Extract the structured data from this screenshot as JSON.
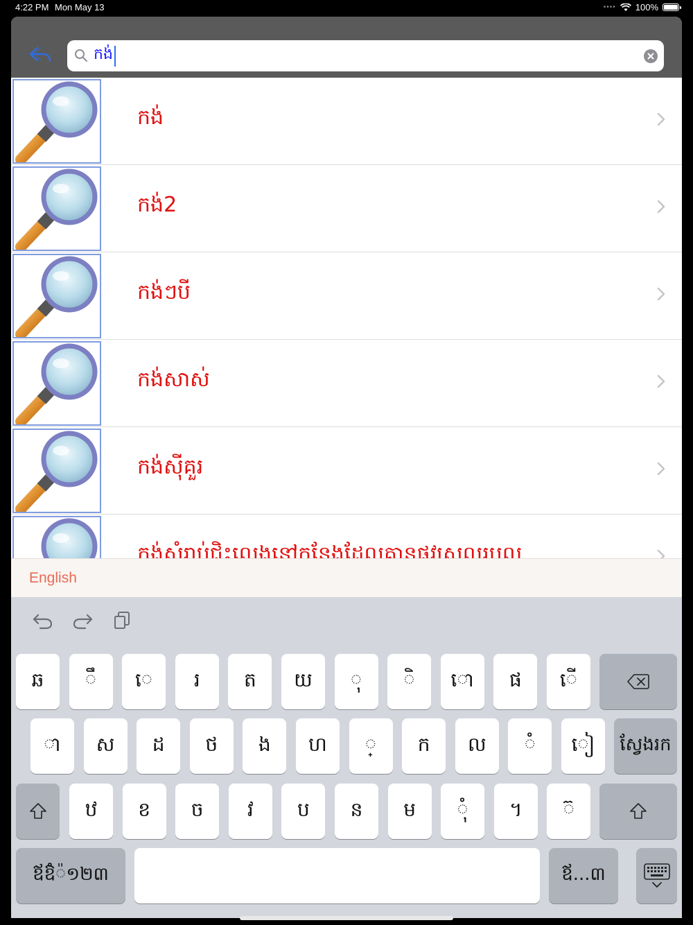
{
  "status": {
    "time": "4:22 PM",
    "date": "Mon May 13",
    "battery": "100%"
  },
  "search": {
    "value": "កង់"
  },
  "results": [
    {
      "label": "កង់"
    },
    {
      "label": "កង់2"
    },
    {
      "label": "កង់ៗបី"
    },
    {
      "label": "កង់សាស់"
    },
    {
      "label": "កង់ស៊ីគួរ"
    },
    {
      "label": "កង់សំរាប់ជិះលេងនៅកន្លែងដែលគ្មានផ្លូវស្រួលរបល"
    }
  ],
  "suggestion": {
    "text": "English"
  },
  "keyboard": {
    "row1": [
      "ឆ",
      "ឹ",
      "េ",
      "រ",
      "ត",
      "យ",
      "ុ",
      "ិ",
      "ោ",
      "ផ",
      "ើ"
    ],
    "row2": [
      "ា",
      "ស",
      "ដ",
      "ថ",
      "ង",
      "ហ",
      "្",
      "ក",
      "ល",
      "ំ",
      "ៀ"
    ],
    "return_label": "ស្វែងរក",
    "row3": [
      "ឋ",
      "ខ",
      "ច",
      "វ",
      "ប",
      "ន",
      "ម",
      "ុំ",
      "។",
      "៊"
    ],
    "mode_label": "ឪឱំ៉១២៣",
    "alt_label": "ឪ...៣"
  },
  "icons": {
    "back": "undo-arrow-icon",
    "search": "magnifier-icon",
    "clear": "clear-circle-icon",
    "thumb": "magnifying-glass-image",
    "chevron": "chevron-right-icon",
    "undo": "undo-icon",
    "redo": "redo-icon",
    "paste": "paste-icon",
    "delete": "delete-icon",
    "shift": "shift-icon",
    "dismiss": "keyboard-dismiss-icon"
  },
  "colors": {
    "result_text": "#e0100f",
    "suggestion_text": "#e86a55",
    "search_text": "#1a1aff",
    "navbar": "#5a5a5a"
  }
}
